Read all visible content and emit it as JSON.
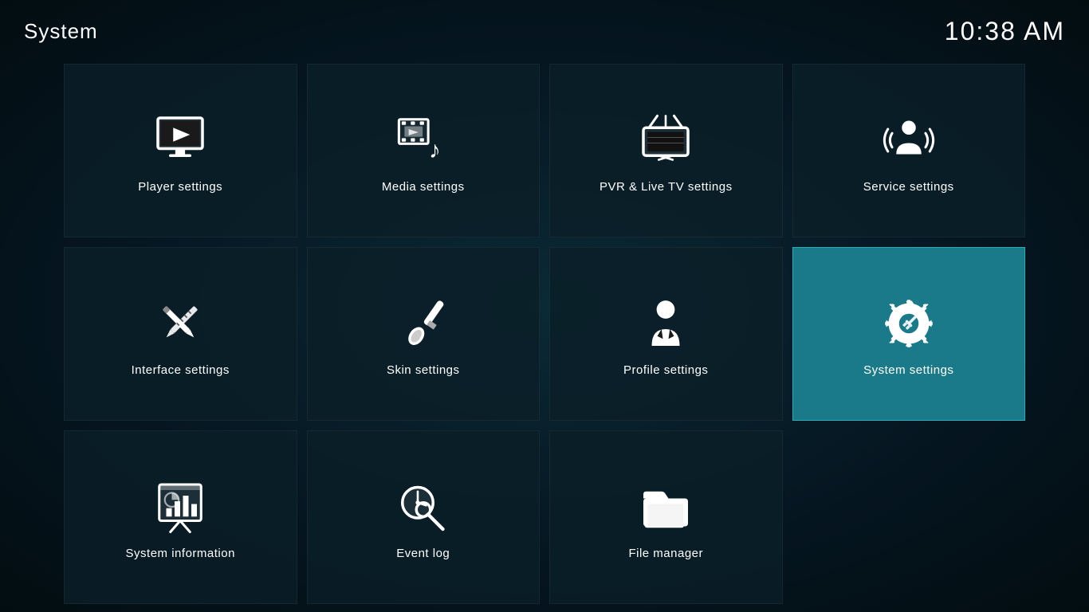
{
  "header": {
    "title": "System",
    "clock": "10:38 AM"
  },
  "tiles": [
    {
      "id": "player-settings",
      "label": "Player settings",
      "icon": "player",
      "active": false
    },
    {
      "id": "media-settings",
      "label": "Media settings",
      "icon": "media",
      "active": false
    },
    {
      "id": "pvr-settings",
      "label": "PVR & Live TV settings",
      "icon": "pvr",
      "active": false
    },
    {
      "id": "service-settings",
      "label": "Service settings",
      "icon": "service",
      "active": false
    },
    {
      "id": "interface-settings",
      "label": "Interface settings",
      "icon": "interface",
      "active": false
    },
    {
      "id": "skin-settings",
      "label": "Skin settings",
      "icon": "skin",
      "active": false
    },
    {
      "id": "profile-settings",
      "label": "Profile settings",
      "icon": "profile",
      "active": false
    },
    {
      "id": "system-settings",
      "label": "System settings",
      "icon": "system",
      "active": true
    },
    {
      "id": "system-information",
      "label": "System information",
      "icon": "sysinfo",
      "active": false
    },
    {
      "id": "event-log",
      "label": "Event log",
      "icon": "eventlog",
      "active": false
    },
    {
      "id": "file-manager",
      "label": "File manager",
      "icon": "filemanager",
      "active": false
    }
  ]
}
